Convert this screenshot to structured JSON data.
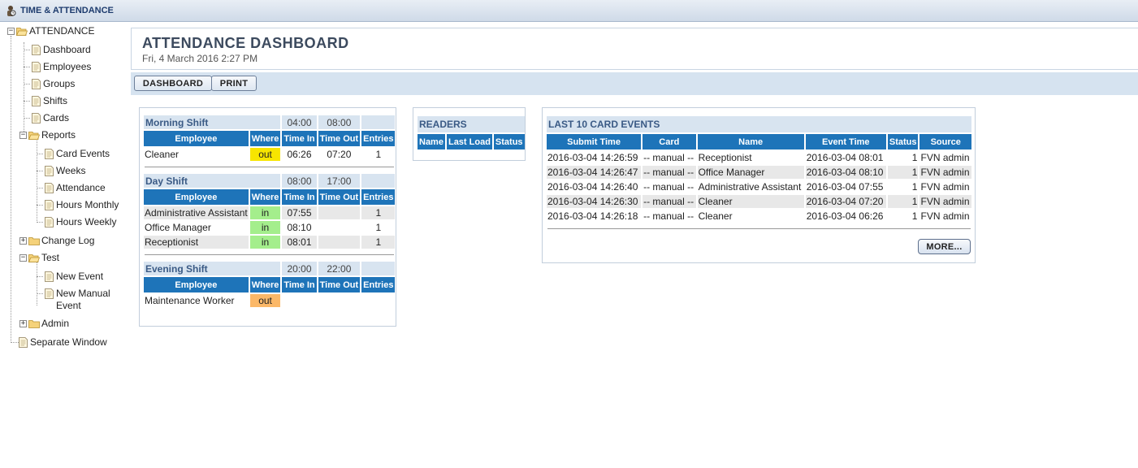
{
  "app": {
    "title": "TIME & ATTENDANCE",
    "icon": "clock-person-icon"
  },
  "sidebar": {
    "root": "ATTENDANCE",
    "items": [
      {
        "label": "Dashboard"
      },
      {
        "label": "Employees"
      },
      {
        "label": "Groups"
      },
      {
        "label": "Shifts"
      },
      {
        "label": "Cards"
      }
    ],
    "reports": {
      "label": "Reports",
      "items": [
        {
          "label": "Card Events"
        },
        {
          "label": "Weeks"
        },
        {
          "label": "Attendance"
        },
        {
          "label": "Hours Monthly"
        },
        {
          "label": "Hours Weekly"
        }
      ]
    },
    "change_log": "Change Log",
    "test": {
      "label": "Test",
      "items": [
        {
          "label": "New Event"
        },
        {
          "label": "New Manual Event",
          "line1": "New Manual",
          "line2": "Event"
        }
      ]
    },
    "admin": "Admin",
    "separate_window": "Separate Window"
  },
  "header": {
    "title": "ATTENDANCE DASHBOARD",
    "date": "Fri, 4 March 2016 2:27 PM"
  },
  "toolbar": {
    "dashboard": "DASHBOARD",
    "print": "PRINT"
  },
  "shifts": {
    "columns": [
      "Employee",
      "Where",
      "Time In",
      "Time Out",
      "Entries"
    ],
    "morning": {
      "name": "Morning Shift",
      "start": "04:00",
      "end": "08:00",
      "rows": [
        {
          "employee": "Cleaner",
          "where": "out",
          "time_in": "06:26",
          "time_out": "07:20",
          "entries": "1"
        }
      ]
    },
    "day": {
      "name": "Day Shift",
      "start": "08:00",
      "end": "17:00",
      "rows": [
        {
          "employee": "Administrative Assistant",
          "where": "in",
          "time_in": "07:55",
          "time_out": "",
          "entries": "1"
        },
        {
          "employee": "Office Manager",
          "where": "in",
          "time_in": "08:10",
          "time_out": "",
          "entries": "1"
        },
        {
          "employee": "Receptionist",
          "where": "in",
          "time_in": "08:01",
          "time_out": "",
          "entries": "1"
        }
      ]
    },
    "evening": {
      "name": "Evening Shift",
      "start": "20:00",
      "end": "22:00",
      "rows": [
        {
          "employee": "Maintenance Worker",
          "where": "out",
          "time_in": "",
          "time_out": "",
          "entries": ""
        }
      ]
    }
  },
  "readers": {
    "title": "READERS",
    "columns": [
      "Name",
      "Last Load",
      "Status"
    ]
  },
  "card_events": {
    "title": "LAST 10 CARD EVENTS",
    "columns": [
      "Submit Time",
      "Card",
      "Name",
      "Event Time",
      "Status",
      "Source"
    ],
    "rows": [
      {
        "submit": "2016-03-04 14:26:59",
        "card": "-- manual --",
        "name": "Receptionist",
        "event": "2016-03-04 08:01",
        "status": "1",
        "source": "FVN admin"
      },
      {
        "submit": "2016-03-04 14:26:47",
        "card": "-- manual --",
        "name": "Office Manager",
        "event": "2016-03-04 08:10",
        "status": "1",
        "source": "FVN admin"
      },
      {
        "submit": "2016-03-04 14:26:40",
        "card": "-- manual --",
        "name": "Administrative Assistant",
        "event": "2016-03-04 07:55",
        "status": "1",
        "source": "FVN admin"
      },
      {
        "submit": "2016-03-04 14:26:30",
        "card": "-- manual --",
        "name": "Cleaner",
        "event": "2016-03-04 07:20",
        "status": "1",
        "source": "FVN admin"
      },
      {
        "submit": "2016-03-04 14:26:18",
        "card": "-- manual --",
        "name": "Cleaner",
        "event": "2016-03-04 06:26",
        "status": "1",
        "source": "FVN admin"
      }
    ],
    "more": "MORE..."
  },
  "colors": {
    "column_header": "#1e74b9",
    "section_header": "#d8e4f0",
    "where_in": "#a4ee8c",
    "where_out_morning": "#f7e500",
    "where_out_evening": "#fbb868"
  }
}
